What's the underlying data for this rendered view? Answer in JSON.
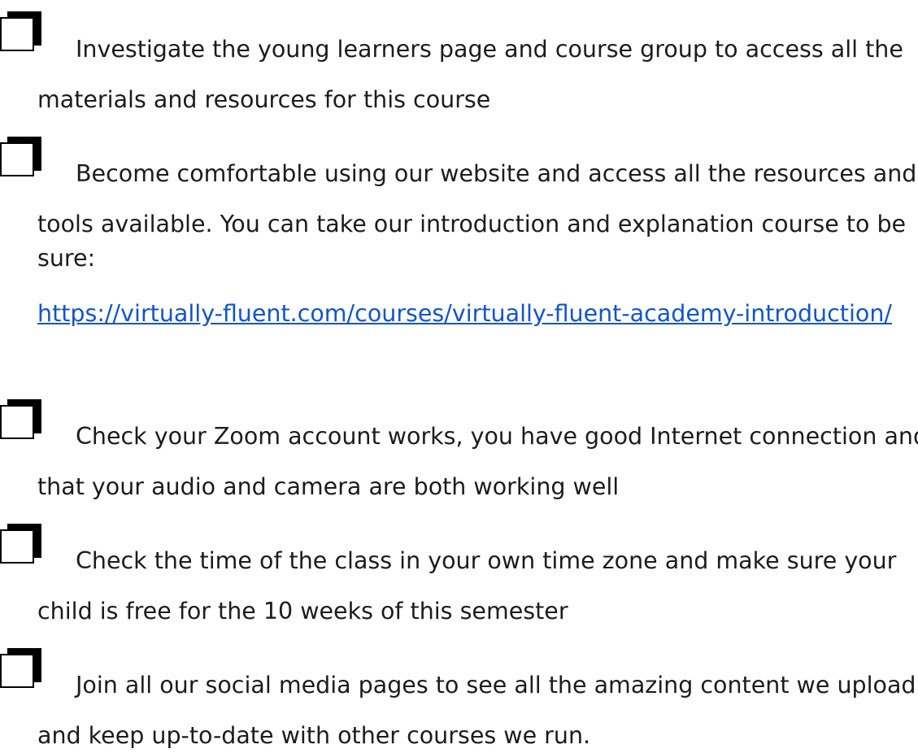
{
  "checklist": [
    {
      "lines": [
        "Investigate the young learners page and course group to access all the",
        "materials and resources for this course"
      ],
      "checked": false
    },
    {
      "lines": [
        "Become comfortable using our website and access all the resources and",
        "tools available. You can take our introduction and explanation course to be",
        "sure:"
      ],
      "checked": false,
      "link": "https://virtually-fluent.com/courses/virtually-fluent-academy-introduction/"
    },
    {
      "lines": [
        "Check your Zoom account works, you have good Internet connection and",
        "that your audio and camera are both working well"
      ],
      "checked": false
    },
    {
      "lines": [
        "Check the time of the class in your own time zone and make sure your",
        "child is free for the 10 weeks of this semester"
      ],
      "checked": false
    },
    {
      "lines": [
        "Join all our social media pages to see all the amazing content we upload",
        "and keep up-to-date with other courses we run."
      ],
      "checked": false
    }
  ]
}
